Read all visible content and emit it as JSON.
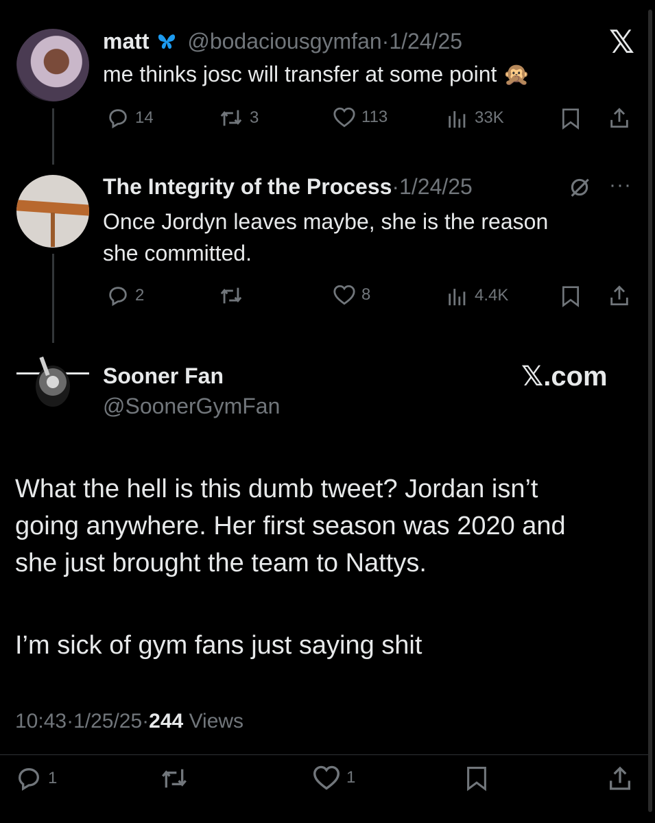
{
  "tweet1": {
    "name": "matt",
    "handle": "@bodaciousgymfan",
    "sep": "·",
    "date": "1/24/25",
    "text": "me thinks josc will transfer at some point",
    "emoji": "🙊",
    "replies": "14",
    "retweets": "3",
    "likes": "113",
    "views": "33K",
    "logo": "𝕏"
  },
  "tweet2": {
    "name": "The Integrity of the Process",
    "sep": "·",
    "date": "1/24/25",
    "text_line1": "Once Jordyn leaves maybe, she is the reason",
    "text_line2": "she committed.",
    "replies": "2",
    "likes": "8",
    "views": "4.4K"
  },
  "main": {
    "name": "Sooner Fan",
    "handle": "@SoonerGymFan",
    "site_label": "𝕏.com",
    "body_line1": "What the hell is this dumb tweet? Jordan isn’t",
    "body_line2": "going anywhere. Her first season was 2020 and",
    "body_line3": "she just brought the team to Nattys.",
    "body_line4": "I’m sick of gym fans just saying shit",
    "time": "10:43",
    "sep": "·",
    "date": "1/25/25",
    "views_count": "244",
    "views_label": "Views",
    "replies": "1",
    "likes": "1"
  },
  "colors": {
    "background": "#000000",
    "text": "#e7e9ea",
    "muted": "#71767b",
    "verified_blue": "#1d9bf0"
  }
}
